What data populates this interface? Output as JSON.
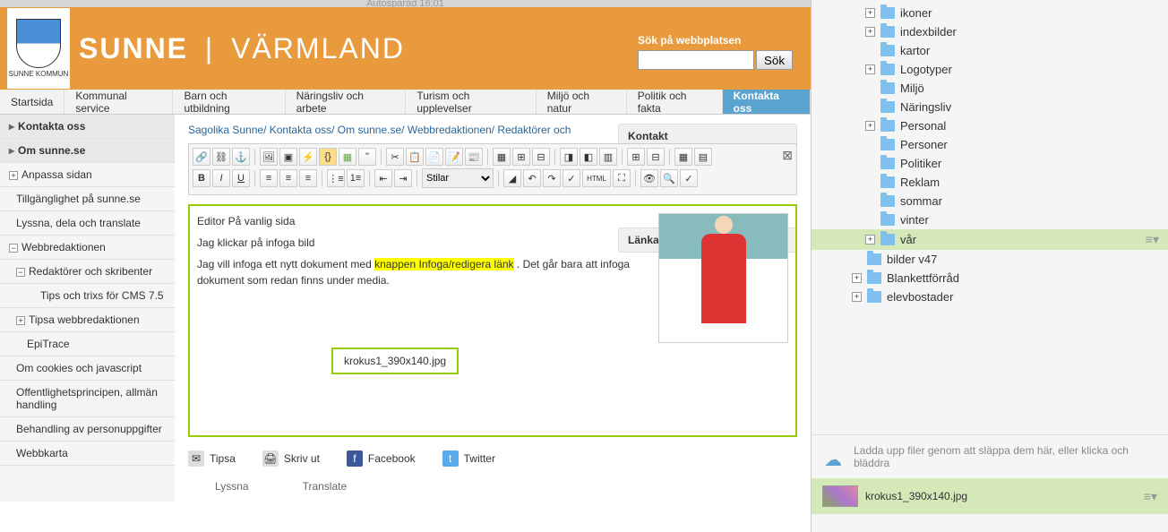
{
  "autosave_text": "Autosparad 16:01",
  "logo": {
    "text": "SUNNE KOMMUN"
  },
  "banner_title_1": "SUNNE",
  "banner_title_2": "VÄRMLAND",
  "search": {
    "label": "Sök på webbplatsen",
    "button": "Sök",
    "value": ""
  },
  "nav": [
    {
      "label": "Startsida"
    },
    {
      "label": "Kommunal service"
    },
    {
      "label": "Barn och utbildning"
    },
    {
      "label": "Näringsliv och arbete"
    },
    {
      "label": "Turism och upplevelser"
    },
    {
      "label": "Miljö och natur"
    },
    {
      "label": "Politik och fakta"
    },
    {
      "label": "Kontakta oss",
      "active": true
    }
  ],
  "sidebar": [
    {
      "label": "Kontakta oss",
      "header": true,
      "arrow": true
    },
    {
      "label": "Om sunne.se",
      "header": true,
      "arrow": true
    },
    {
      "label": "Anpassa sidan",
      "expand": "+"
    },
    {
      "label": "Tillgänglighet på sunne.se",
      "sub": 1
    },
    {
      "label": "Lyssna, dela och translate",
      "sub": 1
    },
    {
      "label": "Webbredaktionen",
      "expand": "−",
      "sub": 0
    },
    {
      "label": "Redaktörer och skribenter",
      "expand": "−",
      "sub": 1
    },
    {
      "label": "Tips och trixs för CMS 7.5",
      "sub": 3
    },
    {
      "label": "Tipsa webbredaktionen",
      "expand": "+",
      "sub": 1
    },
    {
      "label": "EpiTrace",
      "sub": 2
    },
    {
      "label": "Om cookies och javascript",
      "sub": 1
    },
    {
      "label": "Offentlighetsprincipen, allmän handling",
      "sub": 1
    },
    {
      "label": "Behandling av personuppgifter",
      "sub": 1
    },
    {
      "label": "Webbkarta",
      "sub": 1
    }
  ],
  "breadcrumb": [
    "Sagolika Sunne",
    "Kontakta oss",
    "Om sunne.se",
    "Webbredaktionen",
    "Redaktörer och"
  ],
  "right_sections": [
    "Kontakt",
    "Länkar"
  ],
  "toolbar": {
    "style_select": "Stilar",
    "html_btn": "HTML"
  },
  "editor": {
    "line1": "Editor På vanlig sida",
    "line2": "Jag klickar på infoga bild",
    "line3a": "Jag vill infoga ett nytt dokument med ",
    "line3b": "knappen Infoga/redigera länk",
    "line3c": " . Det går bara att infoga dokument som redan finns under media.",
    "filebox": "krokus1_390x140.jpg"
  },
  "share": [
    {
      "label": "Tipsa",
      "icon": "✉",
      "bg": "#ddd"
    },
    {
      "label": "Skriv ut",
      "icon": "🖨",
      "bg": "#ddd"
    },
    {
      "label": "Facebook",
      "icon": "f",
      "bg": "#3b5998",
      "color": "#fff"
    },
    {
      "label": "Twitter",
      "icon": "t",
      "bg": "#55acee",
      "color": "#fff"
    }
  ],
  "footer_links": [
    "Lyssna",
    "Translate"
  ],
  "tree": [
    {
      "label": "ikoner",
      "expand": "+",
      "depth": 2
    },
    {
      "label": "indexbilder",
      "expand": "+",
      "depth": 2
    },
    {
      "label": "kartor",
      "depth": 2
    },
    {
      "label": "Logotyper",
      "expand": "+",
      "depth": 2
    },
    {
      "label": "Miljö",
      "depth": 2
    },
    {
      "label": "Näringsliv",
      "depth": 2
    },
    {
      "label": "Personal",
      "expand": "+",
      "depth": 2
    },
    {
      "label": "Personer",
      "depth": 2
    },
    {
      "label": "Politiker",
      "depth": 2
    },
    {
      "label": "Reklam",
      "depth": 2
    },
    {
      "label": "sommar",
      "depth": 2
    },
    {
      "label": "vinter",
      "depth": 2
    },
    {
      "label": "vår",
      "expand": "+",
      "depth": 2,
      "selected": true
    },
    {
      "label": "bilder v47",
      "depth": 1
    },
    {
      "label": "Blankettförråd",
      "expand": "+",
      "depth": 1
    },
    {
      "label": "elevbostader",
      "expand": "+",
      "depth": 1
    }
  ],
  "upload_text": "Ladda upp filer genom att släppa dem här, eller klicka och bläddra",
  "selected_file": "krokus1_390x140.jpg"
}
